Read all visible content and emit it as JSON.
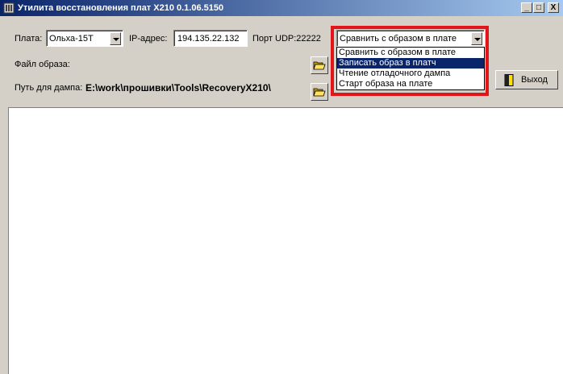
{
  "window": {
    "title": "Утилита восстановления плат X210 0.1.06.5150",
    "minimize": "_",
    "maximize": "□",
    "close": "X"
  },
  "board": {
    "label": "Плата:",
    "value": "Ольха-15Т"
  },
  "ip": {
    "label": "IP-адрес:",
    "value": "194.135.22.132"
  },
  "udp_port": {
    "label": "Порт UDP:22222"
  },
  "action": {
    "selected": "Сравнить с образом в плате",
    "options": [
      "Сравнить с образом в плате",
      "Записать образ в платч",
      "Чтение отладочного дампа",
      "Старт образа на плате"
    ],
    "highlighted_option": "Записать образ в платч"
  },
  "image_file": {
    "label": "Файл образа:",
    "value": ""
  },
  "dump_path": {
    "label": "Путь для дампа:",
    "value": "E:\\work\\прошивки\\Tools\\RecoveryX210\\"
  },
  "exit_button": {
    "label": "Выход"
  },
  "colors": {
    "titlebar_start": "#0a246a",
    "titlebar_end": "#a6caf0",
    "highlight_border": "#e2161a",
    "selection": "#0a246a"
  }
}
